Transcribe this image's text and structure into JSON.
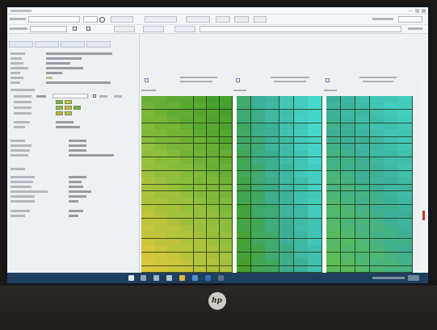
{
  "window": {
    "title": ""
  },
  "toolbar": {
    "buttons": [
      "",
      "",
      "",
      "",
      "",
      ""
    ],
    "fields": [
      "",
      ""
    ]
  },
  "left_panel": {
    "tabs": [
      "",
      "",
      "",
      ""
    ],
    "properties": [
      {
        "label": "",
        "value": ""
      },
      {
        "label": "",
        "value": ""
      },
      {
        "label": "",
        "value": ""
      },
      {
        "label": "",
        "value": ""
      },
      {
        "label": "",
        "value": ""
      },
      {
        "label": "",
        "value": ""
      },
      {
        "label": "",
        "value": ""
      },
      {
        "label": "",
        "value": ""
      }
    ]
  },
  "heatmaps": [
    {
      "title": "",
      "subtitle": ""
    },
    {
      "title": "",
      "subtitle": ""
    },
    {
      "title": "",
      "subtitle": ""
    }
  ],
  "colors": {
    "accent": "#1f3f5e",
    "plot_green": "#4aa32a",
    "plot_yellow": "#d6c83c",
    "plot_cyan": "#4ad8d0"
  },
  "icons": [
    "search-icon",
    "windows-start-icon",
    "hp-logo-icon"
  ]
}
